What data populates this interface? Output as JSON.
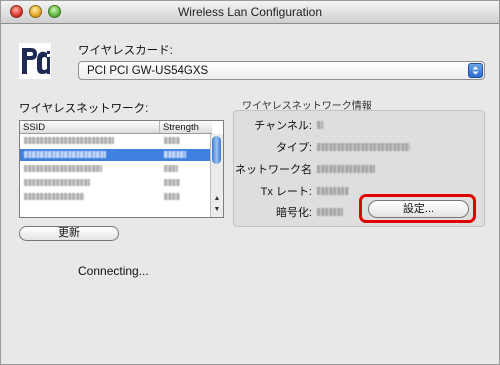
{
  "window": {
    "title": "Wireless Lan Configuration"
  },
  "logo": {
    "text": "PCI"
  },
  "card": {
    "label": "ワイヤレスカード:",
    "selected": "PCI PCI GW-US54GXS"
  },
  "network_list": {
    "label": "ワイヤレスネットワーク:",
    "columns": [
      "SSID",
      "Strength"
    ],
    "rows": [
      {
        "selected": false
      },
      {
        "selected": true
      },
      {
        "selected": false
      },
      {
        "selected": false
      },
      {
        "selected": false
      }
    ],
    "refresh_button": "更新"
  },
  "info": {
    "title": "ワイヤレスネットワーク情報",
    "channel_label": "チャンネル:",
    "type_label": "タイプ:",
    "network_name_label": "ネットワーク名",
    "tx_rate_label": "Tx レート:",
    "encryption_label": "暗号化:",
    "settings_button": "設定..."
  },
  "status": {
    "text": "Connecting..."
  },
  "colors": {
    "selection": "#3d80df",
    "highlight": "#e10000"
  }
}
